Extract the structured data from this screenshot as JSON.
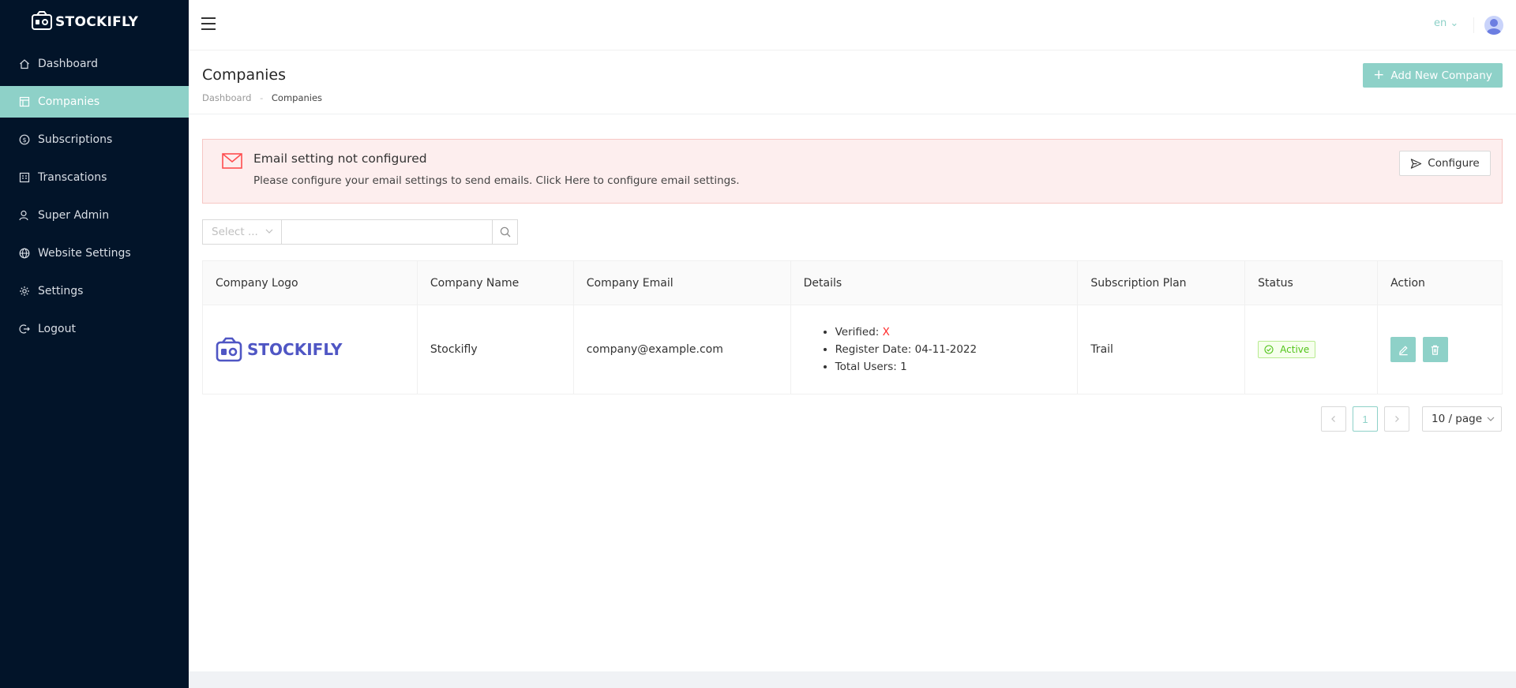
{
  "app": {
    "brand": "STOCKIFLY"
  },
  "sidebar": {
    "items": [
      {
        "label": "Dashboard",
        "icon": "home-icon"
      },
      {
        "label": "Companies",
        "icon": "building-icon",
        "active": true
      },
      {
        "label": "Subscriptions",
        "icon": "dollar-circle-icon"
      },
      {
        "label": "Transcations",
        "icon": "receipt-icon"
      },
      {
        "label": "Super Admin",
        "icon": "user-icon"
      },
      {
        "label": "Website Settings",
        "icon": "globe-icon"
      },
      {
        "label": "Settings",
        "icon": "gear-icon"
      },
      {
        "label": "Logout",
        "icon": "logout-icon"
      }
    ]
  },
  "header": {
    "language": "en"
  },
  "page": {
    "title": "Companies",
    "breadcrumb": [
      "Dashboard",
      "Companies"
    ],
    "add_button": "Add New Company"
  },
  "alert": {
    "title": "Email setting not configured",
    "description": "Please configure your email settings to send emails. Click Here to configure email settings.",
    "button": "Configure"
  },
  "filters": {
    "select_placeholder": "Select ...",
    "search_value": ""
  },
  "table": {
    "columns": [
      "Company Logo",
      "Company Name",
      "Company Email",
      "Details",
      "Subscription Plan",
      "Status",
      "Action"
    ],
    "rows": [
      {
        "logo_text": "STOCKIFLY",
        "name": "Stockifly",
        "email": "company@example.com",
        "verified_label": "Verified:",
        "verified_value": "X",
        "register_label": "Register Date:",
        "register_date": "04-11-2022",
        "users_label": "Total Users:",
        "total_users": "1",
        "plan": "Trail",
        "status": "Active"
      }
    ]
  },
  "pagination": {
    "current_page": "1",
    "page_size": "10 / page"
  },
  "colors": {
    "sidebar_bg": "#021429",
    "accent": "#8ed1c8",
    "alert_bg": "#fdeeee",
    "status_green": "#52c41a",
    "logo_blue": "#4f56c4"
  }
}
